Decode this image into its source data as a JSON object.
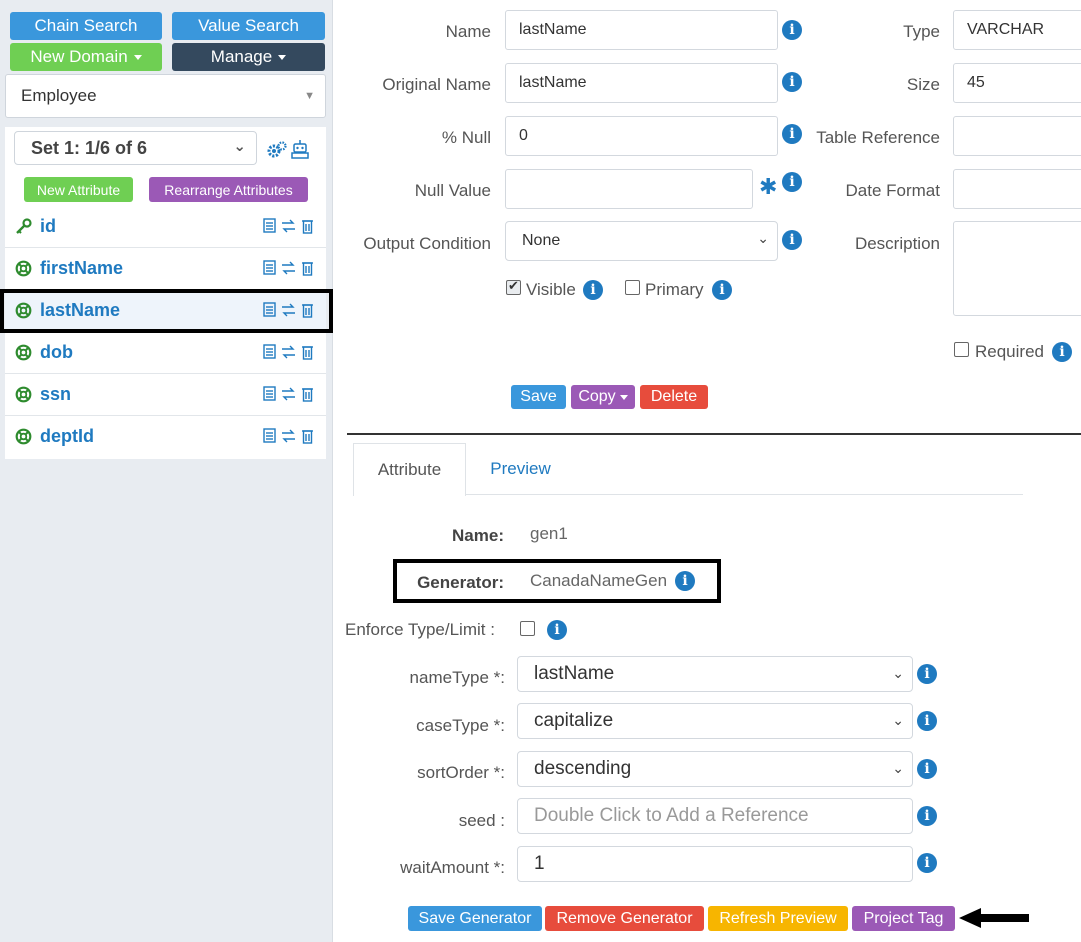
{
  "left": {
    "chain_search": "Chain Search",
    "value_search": "Value Search",
    "new_domain": "New Domain",
    "manage": "Manage",
    "domain": "Employee",
    "set_label": "Set 1: 1/6 of 6",
    "new_attribute": "New Attribute",
    "rearrange_attributes": "Rearrange Attributes",
    "attributes": [
      {
        "name": "id",
        "icon": "key-icon"
      },
      {
        "name": "firstName",
        "icon": "lifebuoy-icon"
      },
      {
        "name": "lastName",
        "icon": "lifebuoy-icon",
        "selected": true
      },
      {
        "name": "dob",
        "icon": "lifebuoy-icon"
      },
      {
        "name": "ssn",
        "icon": "lifebuoy-icon"
      },
      {
        "name": "deptId",
        "icon": "lifebuoy-icon"
      }
    ]
  },
  "form": {
    "name_label": "Name",
    "name_value": "lastName",
    "original_name_label": "Original Name",
    "original_name_value": "lastName",
    "pct_null_label": "% Null",
    "pct_null_value": "0",
    "null_value_label": "Null Value",
    "null_value_value": "",
    "required_mark": "✱",
    "output_condition_label": "Output Condition",
    "output_condition_value": "None",
    "visible_label": "Visible",
    "visible_checked": true,
    "primary_label": "Primary",
    "primary_checked": false,
    "type_label": "Type",
    "type_value": "VARCHAR",
    "size_label": "Size",
    "size_value": "45",
    "table_reference_label": "Table Reference",
    "table_reference_value": "",
    "date_format_label": "Date Format",
    "date_format_value": "",
    "description_label": "Description",
    "description_value": "",
    "required_label": "Required",
    "required_checked": false,
    "save": "Save",
    "copy": "Copy",
    "delete": "Delete"
  },
  "tabs": {
    "attribute": "Attribute",
    "preview": "Preview"
  },
  "generator": {
    "name_label": "Name:",
    "name_value": "gen1",
    "generator_label": "Generator:",
    "generator_value": "CanadaNameGen",
    "enforce_label": "Enforce Type/Limit :",
    "enforce_checked": false,
    "name_type_label": "nameType *:",
    "name_type_value": "lastName",
    "case_type_label": "caseType *:",
    "case_type_value": "capitalize",
    "sort_order_label": "sortOrder *:",
    "sort_order_value": "descending",
    "seed_label": "seed :",
    "seed_placeholder": "Double Click to Add a Reference",
    "wait_amount_label": "waitAmount *:",
    "wait_amount_value": "1",
    "save_generator": "Save Generator",
    "remove_generator": "Remove Generator",
    "refresh_preview": "Refresh Preview",
    "project_tag": "Project Tag"
  },
  "colors": {
    "primary_blue": "#3a97dc",
    "green": "#6fcf53",
    "dark": "#34495e",
    "purple": "#9b59b6",
    "red": "#e74c3c",
    "orange": "#f7b500",
    "link_blue": "#1f7ac0"
  }
}
